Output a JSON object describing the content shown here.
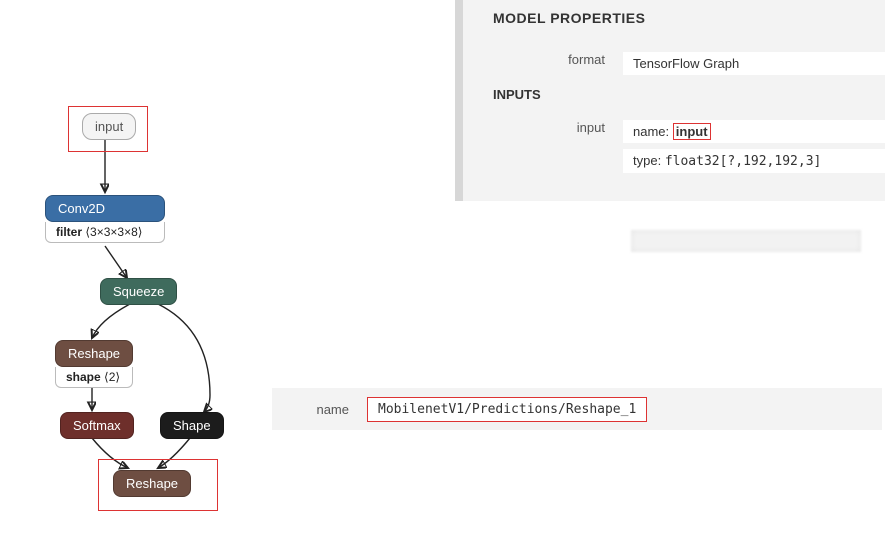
{
  "graph": {
    "input": {
      "label": "input"
    },
    "conv": {
      "label": "Conv2D",
      "filter_key": "filter",
      "filter_val": "⟨3×3×3×8⟩"
    },
    "squeeze": {
      "label": "Squeeze"
    },
    "reshape1": {
      "label": "Reshape",
      "shape_key": "shape",
      "shape_val": "⟨2⟩"
    },
    "softmax": {
      "label": "Softmax"
    },
    "shape": {
      "label": "Shape"
    },
    "reshape2": {
      "label": "Reshape"
    }
  },
  "props": {
    "headings": {
      "model_properties": "MODEL PROPERTIES",
      "inputs": "INPUTS"
    },
    "format": {
      "key": "format",
      "val": "TensorFlow Graph"
    },
    "input_row": {
      "key": "input",
      "name_key": "name:",
      "name_val": "input",
      "type_key": "type:",
      "type_val": "float32[?,192,192,3]"
    }
  },
  "namebar": {
    "key": "name",
    "val": "MobilenetV1/Predictions/Reshape_1"
  }
}
